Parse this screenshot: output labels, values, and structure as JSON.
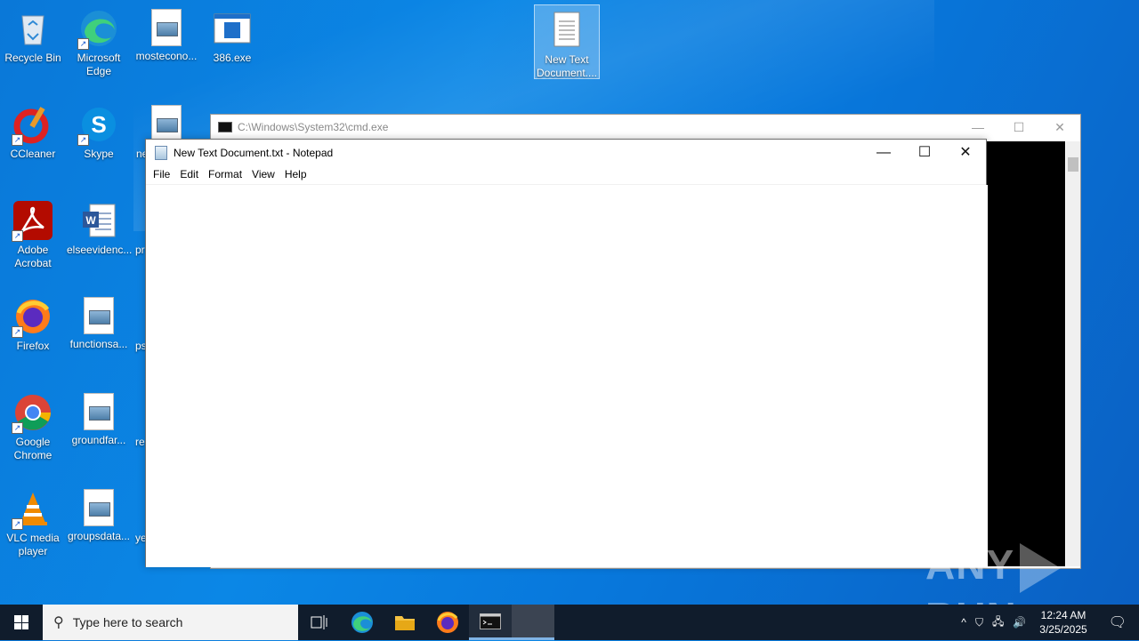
{
  "desktop": {
    "icons": [
      {
        "label": "Recycle Bin"
      },
      {
        "label": "Microsoft Edge"
      },
      {
        "label": "mosteconо..."
      },
      {
        "label": "386.exe"
      },
      {
        "label": "New Text Document...."
      },
      {
        "label": "CCleaner"
      },
      {
        "label": "Skype"
      },
      {
        "label": "ne"
      },
      {
        "label": "Adobe Acrobat"
      },
      {
        "label": "elseevidenc..."
      },
      {
        "label": "pr"
      },
      {
        "label": "Firefox"
      },
      {
        "label": "functionsa..."
      },
      {
        "label": "ps"
      },
      {
        "label": "Google Chrome"
      },
      {
        "label": "groundfar..."
      },
      {
        "label": "re"
      },
      {
        "label": "VLC media player"
      },
      {
        "label": "groupsdata..."
      },
      {
        "label": "ye"
      }
    ]
  },
  "cmd_window": {
    "title": "C:\\Windows\\System32\\cmd.exe",
    "minimize": "—",
    "maximize": "☐",
    "close": "✕"
  },
  "notepad": {
    "title": "New Text Document.txt - Notepad",
    "minimize": "—",
    "maximize": "☐",
    "close": "✕",
    "menu": [
      "File",
      "Edit",
      "Format",
      "View",
      "Help"
    ],
    "content": ""
  },
  "watermark": {
    "left": "ANY",
    "right": "RUN"
  },
  "taskbar": {
    "search_placeholder": "Type here to search",
    "time": "12:24 AM",
    "date": "3/25/2025",
    "tray_up": "^"
  },
  "colors": {
    "desktop": "#0a78d8",
    "taskbar": "#101c2c"
  }
}
